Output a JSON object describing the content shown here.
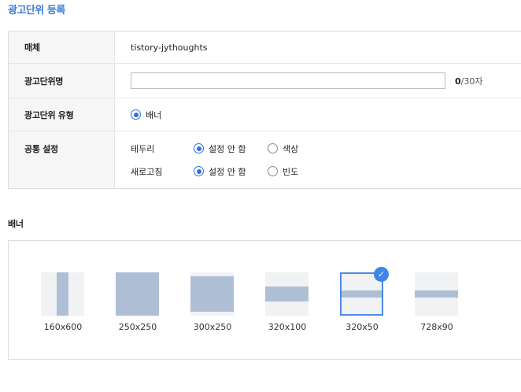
{
  "page": {
    "title": "광고단위 등록"
  },
  "form": {
    "media": {
      "label": "매체",
      "value": "tistory-jythoughts"
    },
    "unit_name": {
      "label": "광고단위명",
      "value": "",
      "placeholder": "",
      "counter_current": "0",
      "counter_max": "/30자"
    },
    "unit_type": {
      "label": "광고단위 유형",
      "option": "배너"
    },
    "common": {
      "label": "공통 설정",
      "border": {
        "label": "테두리",
        "opt1": "설정 안 함",
        "opt2": "색상"
      },
      "refresh": {
        "label": "새로고침",
        "opt1": "설정 안 함",
        "opt2": "빈도"
      }
    }
  },
  "banner": {
    "title": "배너",
    "sizes": [
      "160x600",
      "250x250",
      "300x250",
      "320x100",
      "320x50",
      "728x90"
    ],
    "selected": "320x50"
  },
  "colors": {
    "accent": "#3d85e6",
    "title": "#3a7bd5",
    "thumb_fill": "#aebed5"
  },
  "icons": {
    "selected_badge": "check-icon"
  }
}
